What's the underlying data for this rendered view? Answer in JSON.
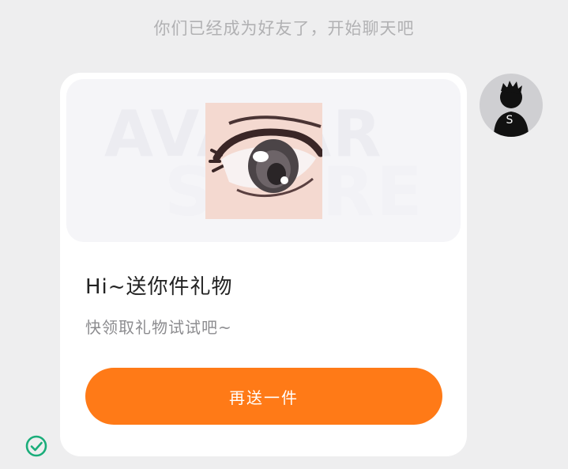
{
  "system_notice": "你们已经成为好友了，开始聊天吧",
  "avatar": {
    "initial": "S"
  },
  "gift_card": {
    "watermark_top": "AVATAR",
    "watermark_bottom": "STORE",
    "title": "Hi~送你件礼物",
    "subtitle": "快领取礼物试试吧~",
    "button_label": "再送一件"
  },
  "colors": {
    "accent": "#ff7a17",
    "sent_status": "#1aad7a"
  },
  "icons": {
    "status": "check-circle-icon",
    "gift_item": "anime-eye-icon"
  }
}
